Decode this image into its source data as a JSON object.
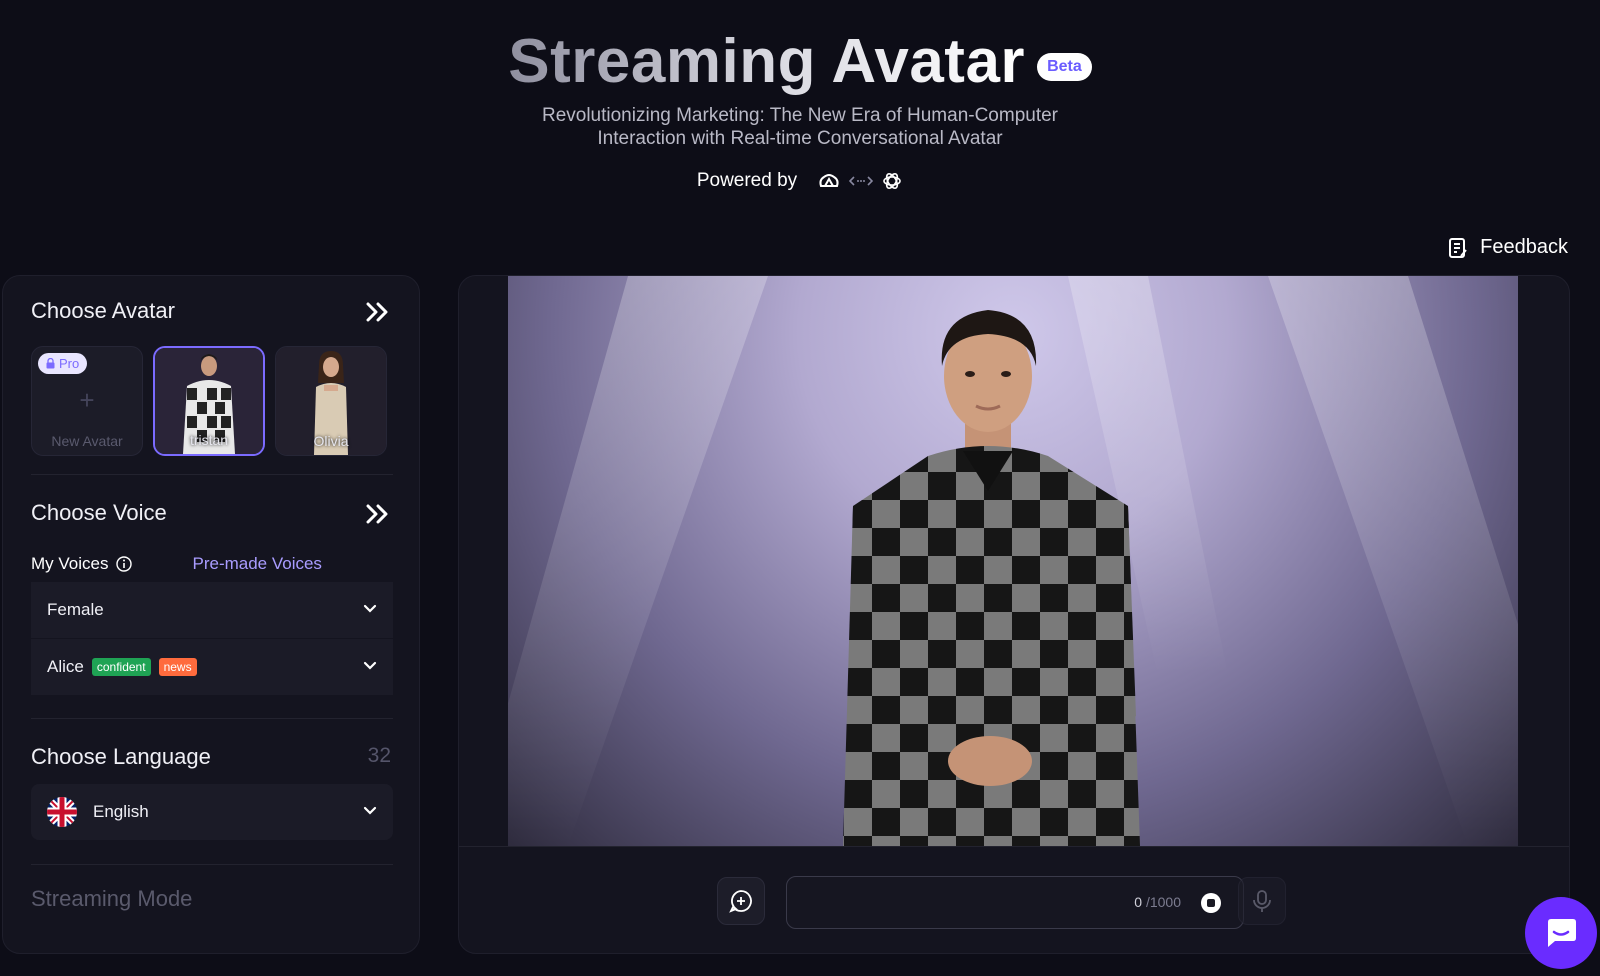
{
  "header": {
    "title": "Streaming Avatar",
    "badge": "Beta",
    "subtitle_line1": "Revolutionizing Marketing: The New Era of Human-Computer",
    "subtitle_line2": "Interaction with Real-time Conversational Avatar",
    "powered_by": "Powered by"
  },
  "feedback": {
    "label": "Feedback",
    "icon": "feedback-icon"
  },
  "sidebar": {
    "avatar_section": {
      "title": "Choose Avatar",
      "cards": [
        {
          "label": "New Avatar",
          "badge": "Pro",
          "icon": "plus-icon",
          "selected": false
        },
        {
          "label": "tristan",
          "selected": true
        },
        {
          "label": "Olivia",
          "selected": false
        }
      ]
    },
    "voice_section": {
      "title": "Choose Voice",
      "tabs": [
        {
          "label": "My Voices",
          "active": false,
          "icon": "info-icon"
        },
        {
          "label": "Pre-made Voices",
          "active": true
        }
      ],
      "gender": "Female",
      "voice": {
        "name": "Alice",
        "tags": [
          "confident",
          "news"
        ]
      }
    },
    "language_section": {
      "title": "Choose Language",
      "count": "32",
      "selected": "English",
      "flag": "uk-flag-icon"
    },
    "streaming_section": {
      "title": "Streaming Mode"
    }
  },
  "chat": {
    "input_value": "",
    "count": "0",
    "max": "/1000"
  },
  "colors": {
    "background": "#0d0d17",
    "panel": "#14141f",
    "accent": "#7b6bff",
    "tag_green": "#1fa354",
    "tag_orange": "#ff6b3d",
    "chat_button": "#6a2cff"
  }
}
